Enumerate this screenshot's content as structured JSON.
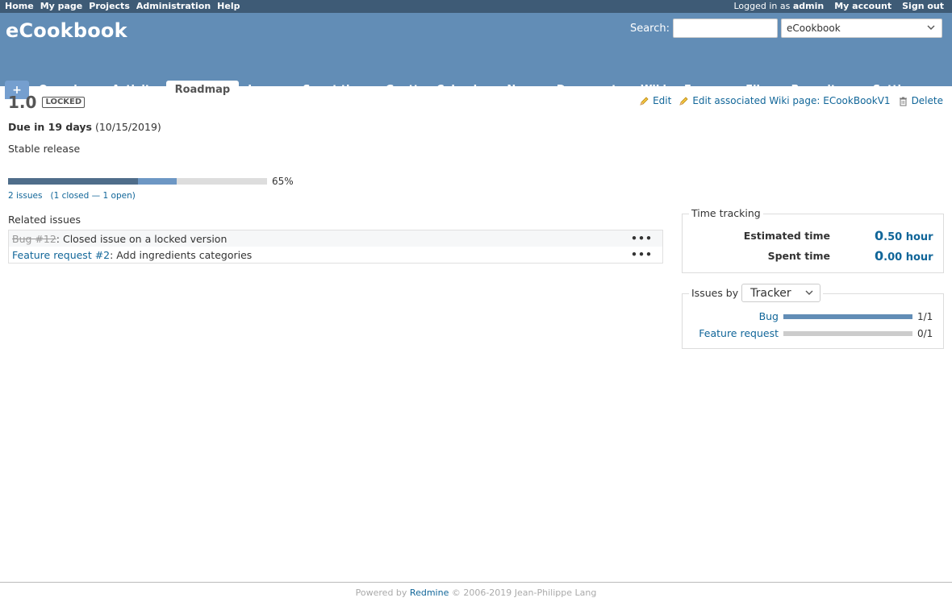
{
  "top_menu": {
    "left": [
      "Home",
      "My page",
      "Projects",
      "Administration",
      "Help"
    ],
    "logged_prefix": "Logged in as",
    "user": "admin",
    "my_account": "My account",
    "sign_out": "Sign out"
  },
  "header": {
    "title": "eCookbook",
    "search_label": "Search:",
    "search_value": "",
    "jump_value": "eCookbook"
  },
  "tabs": {
    "new": "+",
    "items": [
      "Overview",
      "Activity",
      "Roadmap",
      "Issues",
      "Spent time",
      "Gantt",
      "Calendar",
      "News",
      "Documents",
      "Wiki",
      "Forums",
      "Files",
      "Repository",
      "Settings"
    ],
    "selected": "Roadmap"
  },
  "version": {
    "name": "1.0",
    "status": "LOCKED",
    "due_bold": "Due in 19 days",
    "due_date": "(10/15/2019)",
    "description": "Stable release",
    "progress_closed_pct": 50,
    "progress_done_pct": 65,
    "progress_label": "65%",
    "issues_total": "2 issues",
    "closed": "1 closed",
    "dash": "—",
    "open": "1 open"
  },
  "contextual": {
    "edit": "Edit",
    "edit_wiki": "Edit associated Wiki page: ECookBookV1",
    "delete": "Delete"
  },
  "related": {
    "title": "Related issues",
    "issues": [
      {
        "link": "Bug #12",
        "text": ": Closed issue on a locked version",
        "closed": true
      },
      {
        "link": "Feature request #2",
        "text": ": Add ingredients categories",
        "closed": false
      }
    ]
  },
  "time_tracking": {
    "legend": "Time tracking",
    "estimated_label": "Estimated time",
    "estimated_int": "0",
    "estimated_dec": ".50 hour",
    "spent_label": "Spent time",
    "spent_int": "0",
    "spent_dec": ".00 hour"
  },
  "issues_by": {
    "legend": "Issues by",
    "selected": "Tracker",
    "rows": [
      {
        "label": "Bug",
        "count": "1/1",
        "fraction": 1.0
      },
      {
        "label": "Feature request",
        "count": "0/1",
        "fraction": 0.0
      }
    ]
  },
  "footer": {
    "prefix": "Powered by",
    "link": "Redmine",
    "suffix": "© 2006-2019 Jean-Philippe Lang"
  }
}
